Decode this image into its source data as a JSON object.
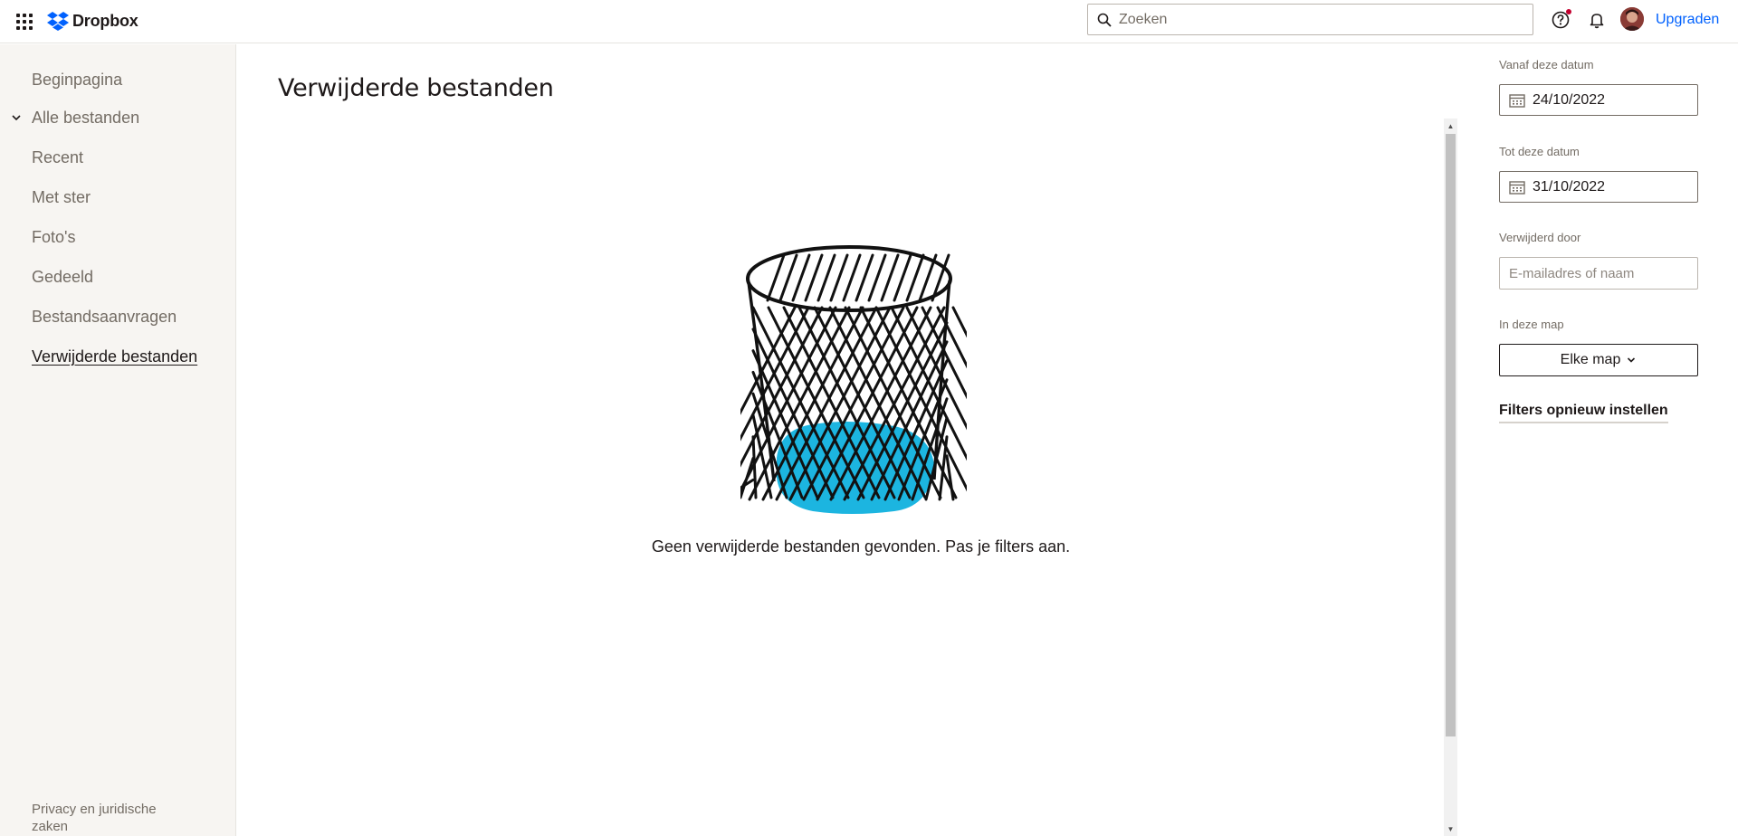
{
  "header": {
    "brand_name": "Dropbox",
    "brand_color": "#0061fe",
    "search_placeholder": "Zoeken",
    "upgrade_label": "Upgraden",
    "icons": [
      "apps-grid-icon",
      "dropbox-logo-icon",
      "search-icon",
      "help-icon",
      "bell-icon",
      "avatar"
    ]
  },
  "sidebar": {
    "items": [
      {
        "label": "Beginpagina"
      },
      {
        "label": "Alle bestanden"
      },
      {
        "label": "Recent"
      },
      {
        "label": "Met ster"
      },
      {
        "label": "Foto's"
      },
      {
        "label": "Gedeeld"
      },
      {
        "label": "Bestandsaanvragen"
      },
      {
        "label": "Verwijderde bestanden",
        "active": true
      }
    ],
    "footer_link": "Privacy en juridische zaken"
  },
  "main": {
    "title": "Verwijderde bestanden",
    "empty_message": "Geen verwijderde bestanden gevonden. Pas je filters aan.",
    "illustration": "trash-bin-illustration",
    "accent_color": "#1cb5e0"
  },
  "filters": {
    "from_label": "Vanaf deze datum",
    "from_value": "24/10/2022",
    "to_label": "Tot deze datum",
    "to_value": "31/10/2022",
    "deleted_by_label": "Verwijderd door",
    "deleted_by_placeholder": "E-mailadres of naam",
    "folder_label": "In deze map",
    "folder_value": "Elke map",
    "reset_label": "Filters opnieuw instellen"
  }
}
